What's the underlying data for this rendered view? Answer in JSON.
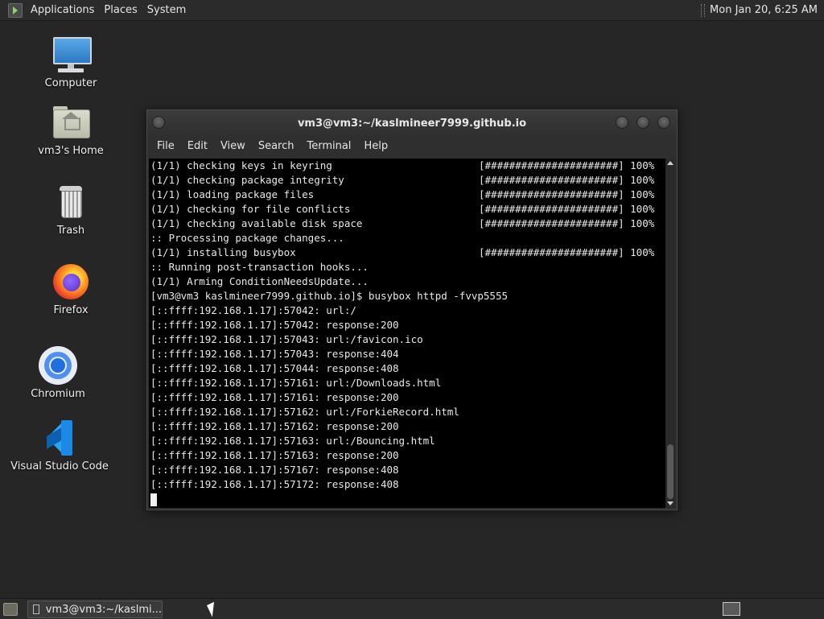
{
  "top_panel": {
    "menu": [
      "Applications",
      "Places",
      "System"
    ],
    "clock": "Mon Jan 20,  6:25 AM"
  },
  "desktop_icons": [
    {
      "label": "Computer",
      "icon": "computer-icon"
    },
    {
      "label": "vm3's Home",
      "icon": "home-folder-icon"
    },
    {
      "label": "Trash",
      "icon": "trash-icon"
    },
    {
      "label": "Firefox",
      "icon": "firefox-icon"
    },
    {
      "label": "Chromium",
      "icon": "chromium-icon"
    },
    {
      "label": "Visual Studio Code",
      "icon": "vscode-icon"
    }
  ],
  "terminal": {
    "title": "vm3@vm3:~/kaslmineer7999.github.io",
    "menu": [
      "File",
      "Edit",
      "View",
      "Search",
      "Terminal",
      "Help"
    ],
    "lines": [
      {
        "text": "(1/1) checking keys in keyring",
        "progress": "[######################] 100%"
      },
      {
        "text": "(1/1) checking package integrity",
        "progress": "[######################] 100%"
      },
      {
        "text": "(1/1) loading package files",
        "progress": "[######################] 100%"
      },
      {
        "text": "(1/1) checking for file conflicts",
        "progress": "[######################] 100%"
      },
      {
        "text": "(1/1) checking available disk space",
        "progress": "[######################] 100%"
      },
      {
        "text": ":: Processing package changes...",
        "progress": ""
      },
      {
        "text": "(1/1) installing busybox",
        "progress": "[######################] 100%"
      },
      {
        "text": ":: Running post-transaction hooks...",
        "progress": ""
      },
      {
        "text": "(1/1) Arming ConditionNeedsUpdate...",
        "progress": ""
      },
      {
        "text": "[vm3@vm3 kaslmineer7999.github.io]$ busybox httpd -fvvp5555",
        "progress": ""
      },
      {
        "text": "[::ffff:192.168.1.17]:57042: url:/",
        "progress": ""
      },
      {
        "text": "[::ffff:192.168.1.17]:57042: response:200",
        "progress": ""
      },
      {
        "text": "[::ffff:192.168.1.17]:57043: url:/favicon.ico",
        "progress": ""
      },
      {
        "text": "[::ffff:192.168.1.17]:57043: response:404",
        "progress": ""
      },
      {
        "text": "[::ffff:192.168.1.17]:57044: response:408",
        "progress": ""
      },
      {
        "text": "[::ffff:192.168.1.17]:57161: url:/Downloads.html",
        "progress": ""
      },
      {
        "text": "[::ffff:192.168.1.17]:57161: response:200",
        "progress": ""
      },
      {
        "text": "[::ffff:192.168.1.17]:57162: url:/ForkieRecord.html",
        "progress": ""
      },
      {
        "text": "[::ffff:192.168.1.17]:57162: response:200",
        "progress": ""
      },
      {
        "text": "[::ffff:192.168.1.17]:57163: url:/Bouncing.html",
        "progress": ""
      },
      {
        "text": "[::ffff:192.168.1.17]:57163: response:200",
        "progress": ""
      },
      {
        "text": "[::ffff:192.168.1.17]:57167: response:408",
        "progress": ""
      },
      {
        "text": "[::ffff:192.168.1.17]:57172: response:408",
        "progress": ""
      }
    ]
  },
  "taskbar": {
    "task_label": "vm3@vm3:~/kaslmi..."
  }
}
